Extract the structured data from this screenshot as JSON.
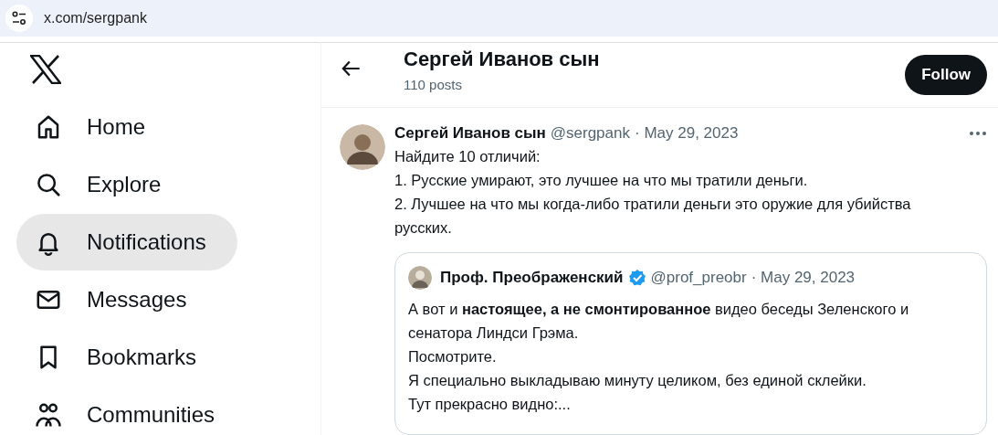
{
  "address_bar": {
    "url": "x.com/sergpank"
  },
  "sidebar": {
    "items": [
      {
        "label": "Home",
        "selected": false
      },
      {
        "label": "Explore",
        "selected": false
      },
      {
        "label": "Notifications",
        "selected": true
      },
      {
        "label": "Messages",
        "selected": false
      },
      {
        "label": "Bookmarks",
        "selected": false
      },
      {
        "label": "Communities",
        "selected": false
      }
    ]
  },
  "header": {
    "title": "Сергей Иванов сын",
    "subtitle": "110 posts",
    "follow_button": "Follow"
  },
  "tweet": {
    "author": "Сергей Иванов сын",
    "handle": "@sergpank",
    "date": "· May 29, 2023",
    "text": "Найдите 10 отличий:\n1. Русские умирают, это лучшее на что мы тратили деньги.\n2. Лучшее на что мы когда-либо тратили деньги это оружие для убийства\nрусских.",
    "quote": {
      "author": "Проф. Преображенский",
      "verified": true,
      "handle": "@prof_preobr",
      "date": "· May 29, 2023",
      "text": "А вот и **настоящее, а не смонтированное** видео беседы Зеленского и\nсенатора Линдси Грэма.\nПосмотрите.\nЯ специально выкладываю минуту целиком, без единой склейки.\nТут прекрасно видно:..."
    }
  }
}
